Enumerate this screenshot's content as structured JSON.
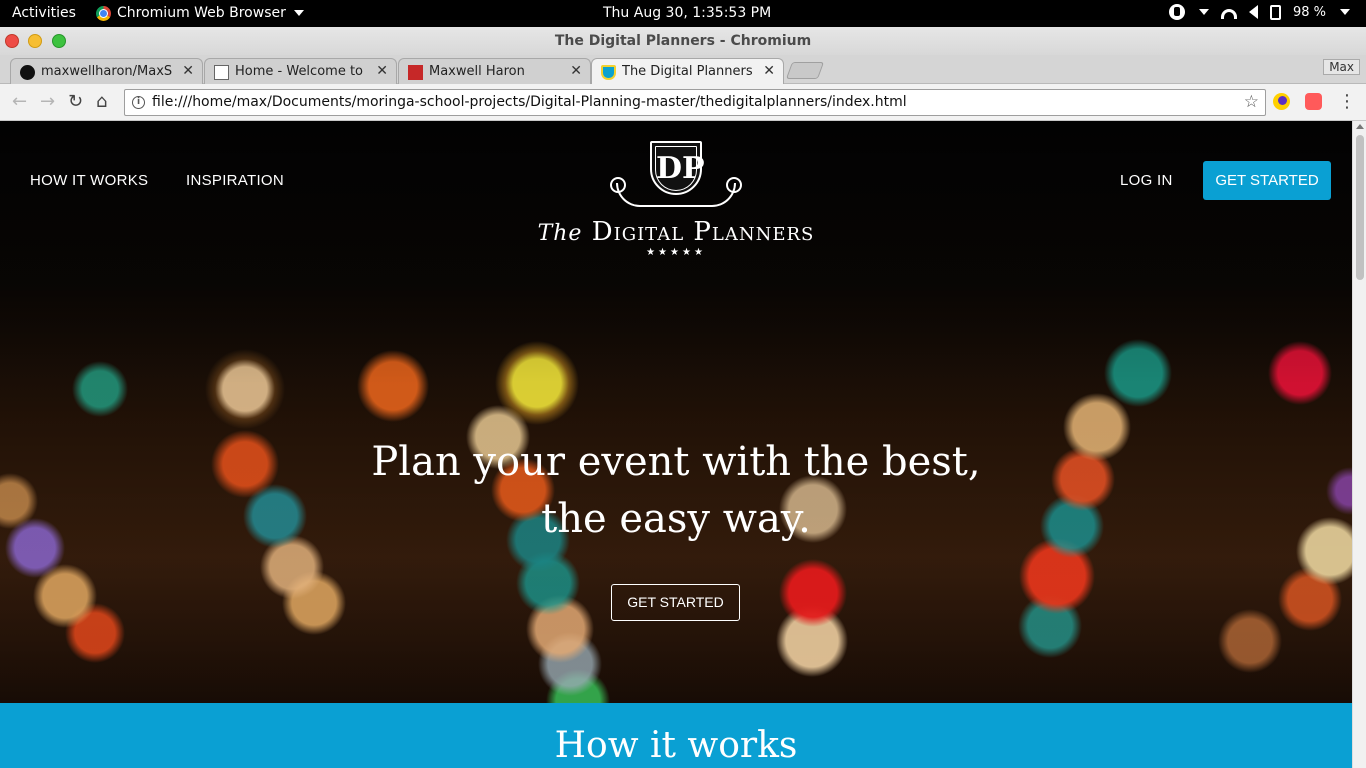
{
  "system_bar": {
    "activities": "Activities",
    "app_name": "Chromium Web Browser",
    "clock": "Thu Aug 30,  1:35:53 PM",
    "battery": "98 %"
  },
  "window": {
    "title": "The Digital Planners - Chromium"
  },
  "tabs": [
    {
      "title": "maxwellharon/MaxShc",
      "icon": "github-icon"
    },
    {
      "title": "Home - Welcome to Th",
      "icon": "document-icon"
    },
    {
      "title": "Maxwell Haron",
      "icon": "red-site-icon"
    },
    {
      "title": "The Digital Planners",
      "icon": "shield-icon",
      "active": true
    }
  ],
  "profile_button": "Max",
  "address_bar": {
    "url": "file:///home/max/Documents/moringa-school-projects/Digital-Planning-master/thedigitalplanners/index.html"
  },
  "site": {
    "nav": {
      "how_it_works": "HOW IT WORKS",
      "inspiration": "INSPIRATION",
      "login": "LOG IN",
      "get_started": "GET STARTED"
    },
    "logo": {
      "monogram": "DP",
      "the": "The",
      "name": "Digital Planners",
      "stars": "★★★★★"
    },
    "hero": {
      "headline_line1": "Plan your event with the best,",
      "headline_line2": "the easy way.",
      "cta": "GET STARTED"
    },
    "how_section": {
      "title": "How it works"
    }
  },
  "colors": {
    "accent": "#0aa0d3",
    "system_bar": "#000000",
    "hero_text": "#ffffff"
  }
}
